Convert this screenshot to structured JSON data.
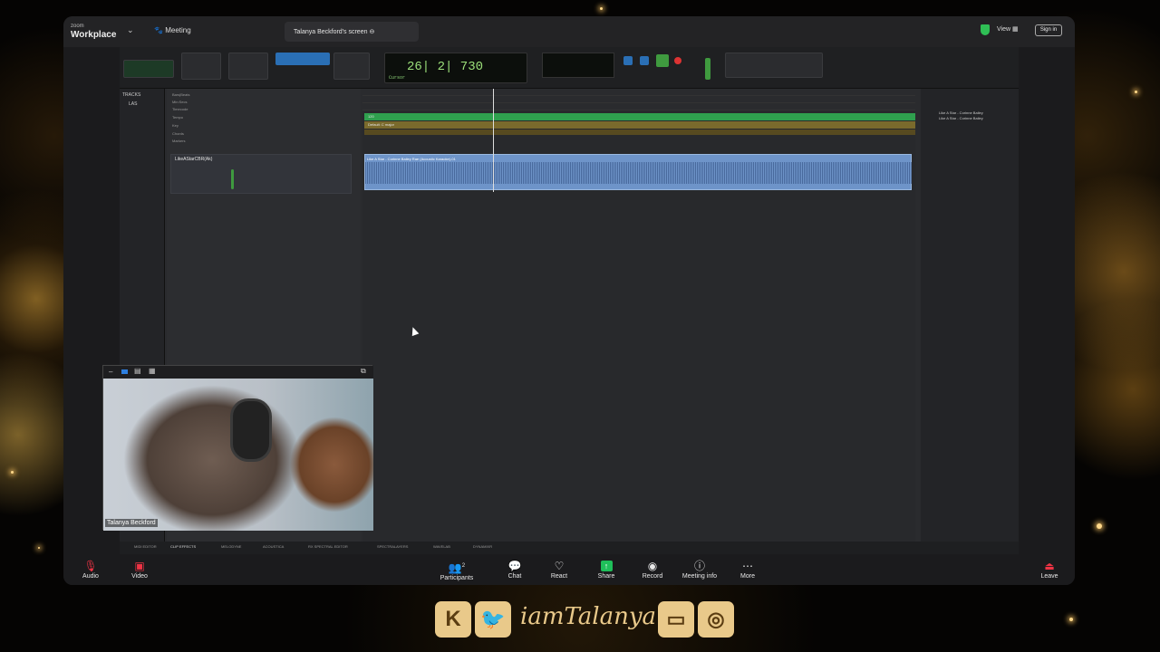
{
  "zoom": {
    "logo_small": "zoom",
    "logo_main": "Workplace",
    "meeting_label": "Meeting",
    "screen_label": "Talanya Beckford's screen",
    "view_label": "View",
    "sign_in": "Sign in"
  },
  "daw": {
    "counter": "26| 2| 730",
    "tracks_title": "TRACKS",
    "track_short": "LAS",
    "track_name": "LikeAStarCBR(Ak)",
    "rulers": [
      "Bars|Beats",
      "Min:Secs",
      "Timecode",
      "Tempo",
      "Key",
      "Chords",
      "Markers"
    ],
    "lane_tempo": "120",
    "lane_key": "Default: C major",
    "clip_label": "Like A Star - Corinne Bailey Rae (Acoustic Karaoke)-01",
    "right_items": [
      "Like A Star - Corinne Bailey",
      "Like A Star - Corinne Bailey"
    ],
    "bottom_tabs": [
      "MIDI EDITOR",
      "CLIP EFFECTS",
      "MELODYNE",
      "ACOUSTICA",
      "RX SPECTRAL EDITOR",
      "SPECTRALAYERS",
      "WAVELAB",
      "DYNAMIXR"
    ]
  },
  "pip": {
    "name": "Talanya Beckford"
  },
  "toolbar": {
    "audio": "Audio",
    "video": "Video",
    "participants": "Participants",
    "participants_count": "2",
    "chat": "Chat",
    "react": "React",
    "share": "Share",
    "record": "Record",
    "meeting_info": "Meeting info",
    "more": "More",
    "leave": "Leave"
  },
  "overlay": {
    "handle": "iamTalanya",
    "kick": "K"
  }
}
